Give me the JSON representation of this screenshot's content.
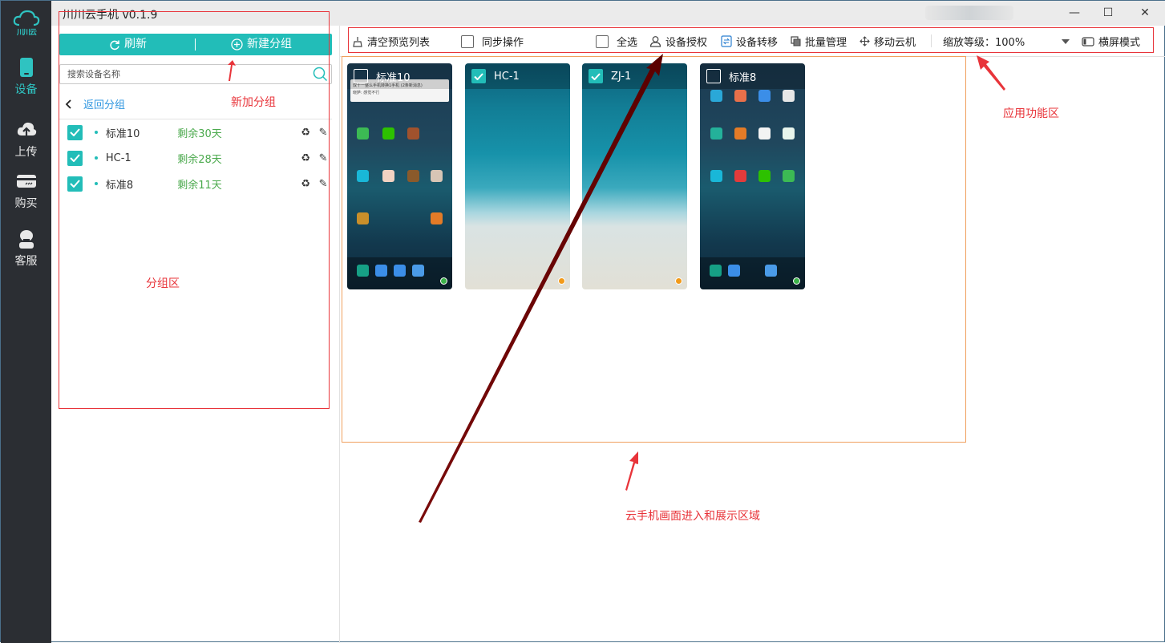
{
  "app": {
    "title": "川川云手机 v0.1.9",
    "logo_text": "川川云"
  },
  "nav": [
    {
      "label": "设备",
      "icon": "phone-icon",
      "active": true
    },
    {
      "label": "上传",
      "icon": "cloud-upload-icon",
      "active": false
    },
    {
      "label": "购买",
      "icon": "card-icon",
      "active": false
    },
    {
      "label": "客服",
      "icon": "headset-icon",
      "active": false
    }
  ],
  "window_controls": {
    "minimize": "—",
    "maximize": "☐",
    "close": "✕"
  },
  "group_panel": {
    "refresh_label": "刷新",
    "new_group_label": "新建分组",
    "search_placeholder": "搜索设备名称",
    "back_label": "返回分组",
    "devices": [
      {
        "name": "标准10",
        "remaining": "剩余30天",
        "checked": true
      },
      {
        "name": "HC-1",
        "remaining": "剩余28天",
        "checked": true
      },
      {
        "name": "标准8",
        "remaining": "剩余11天",
        "checked": true
      }
    ]
  },
  "toolbar": {
    "clear_preview": "清空预览列表",
    "sync_op": "同步操作",
    "select_all": "全选",
    "authorize": "设备授权",
    "transfer": "设备转移",
    "batch": "批量管理",
    "move": "移动云机",
    "zoom": "缩放等级：100%",
    "landscape": "横屏模式"
  },
  "phones": [
    {
      "name": "标准10",
      "checked": false,
      "screen": "home",
      "status_color": "#3cb34a",
      "notification": {
        "line1": "双十一整么手机转换1手机 (2条新消息)",
        "line2": "晓萨: 感觉不行"
      }
    },
    {
      "name": "HC-1",
      "checked": true,
      "screen": "sea",
      "status_color": "#f29a1a"
    },
    {
      "name": "ZJ-1",
      "checked": true,
      "screen": "sea",
      "status_color": "#f29a1a"
    },
    {
      "name": "标准8",
      "checked": false,
      "screen": "home",
      "status_color": "#3cb34a"
    }
  ],
  "annotations": {
    "new_group": "新加分组",
    "group_area": "分组区",
    "function_area": "应用功能区",
    "display_area": "云手机画面进入和展示区域"
  },
  "colors": {
    "accent": "#22bdb8",
    "annotation_red": "#e8343a",
    "remaining_green": "#4caa4e",
    "link_blue": "#2f96e0"
  }
}
